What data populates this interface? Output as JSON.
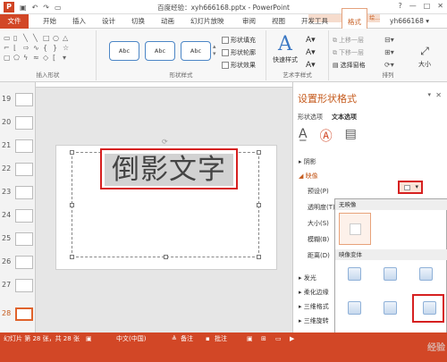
{
  "window": {
    "title": "百度经验：xyh666168.pptx - PowerPoint",
    "controls": [
      "?",
      "—",
      "□",
      "✕"
    ]
  },
  "ribbon_tabs": [
    "文件",
    "开始",
    "插入",
    "设计",
    "切换",
    "动画",
    "幻灯片放映",
    "审阅",
    "视图",
    "开发工具",
    "格式"
  ],
  "context_tab_header": "绘...",
  "user": "yh666168 ▾",
  "ribbon": {
    "insert_shapes_label": "插入形状",
    "shape_styles_label": "形状样式",
    "style_box_label": "Abc",
    "fill": "形状填充",
    "outline": "形状轮廓",
    "effects": "形状效果",
    "quick_styles": "快速样式",
    "wordart_label": "艺术字样式",
    "arrange_label": "排列",
    "bring_forward": "上移一层",
    "send_backward": "下移一层",
    "selection_pane": "选择窗格",
    "size": "大小"
  },
  "slides": [
    {
      "num": "19"
    },
    {
      "num": "20"
    },
    {
      "num": "21"
    },
    {
      "num": "22"
    },
    {
      "num": "23"
    },
    {
      "num": "24"
    },
    {
      "num": "25"
    },
    {
      "num": "26"
    },
    {
      "num": "27"
    },
    {
      "num": "28",
      "selected": true
    }
  ],
  "slide_text": "倒影文字",
  "pane": {
    "title": "设置形状格式",
    "tab_shape": "形状选项",
    "tab_text": "文本选项",
    "sections": {
      "shadow": "阴影",
      "reflection": "映像",
      "preset": "预设(P)",
      "transparency": "透明度(T)",
      "size": "大小(S)",
      "blur": "模糊(B)",
      "distance": "距离(D)",
      "glow": "发光",
      "soft_edges": "柔化边缘",
      "three_d_format": "三维格式",
      "three_d_rotation": "三维旋转"
    }
  },
  "popup": {
    "none_header": "无映像",
    "variants_header": "映像变体"
  },
  "status": {
    "slide": "幻灯片 第 28 张，共 28 张",
    "lang": "中文(中国)",
    "notes": "备注",
    "comments": "批注"
  },
  "watermark": "经验"
}
